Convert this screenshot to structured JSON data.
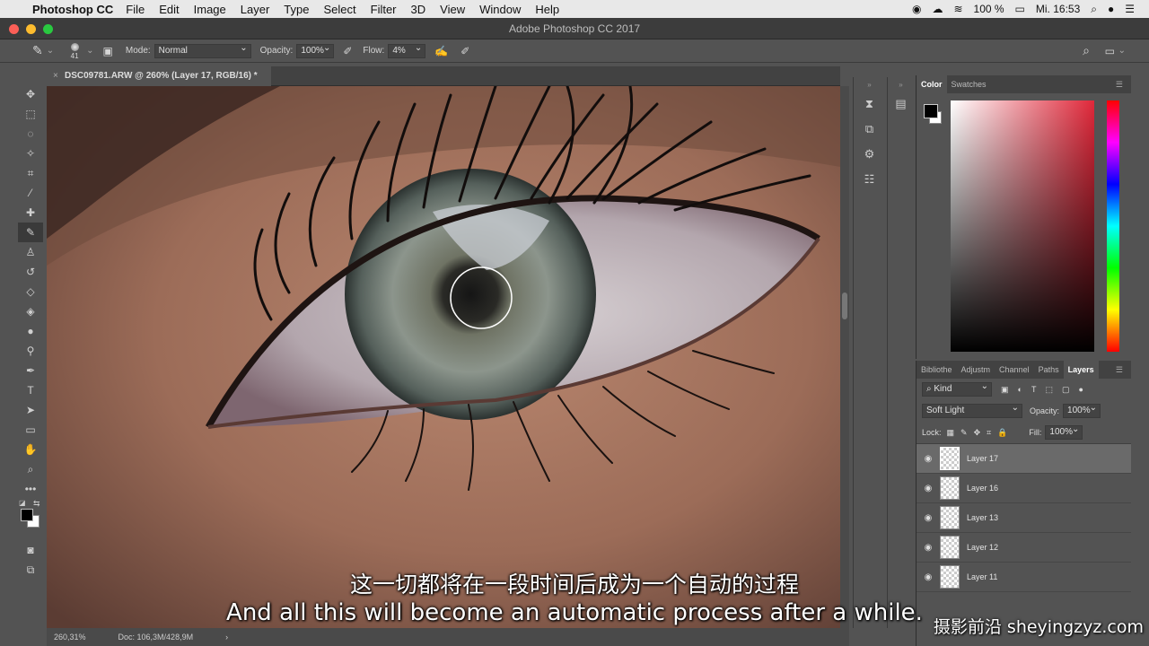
{
  "menubar": {
    "app_name": "Photoshop CC",
    "items": [
      "File",
      "Edit",
      "Image",
      "Layer",
      "Type",
      "Select",
      "Filter",
      "3D",
      "View",
      "Window",
      "Help"
    ],
    "battery": "100 %",
    "clock": "Mi. 16:53"
  },
  "window": {
    "title": "Adobe Photoshop CC 2017"
  },
  "options": {
    "brush_size": "41",
    "mode_label": "Mode:",
    "mode_value": "Normal",
    "opacity_label": "Opacity:",
    "opacity_value": "100%",
    "flow_label": "Flow:",
    "flow_value": "4%"
  },
  "document": {
    "tab_title": "DSC09781.ARW @ 260% (Layer 17, RGB/16) *",
    "zoom": "260,31%",
    "doc_size": "Doc: 106,3M/428,9M"
  },
  "color_panel": {
    "tabs": [
      "Color",
      "Swatches"
    ],
    "active": "Color"
  },
  "layers_panel": {
    "tabs": [
      "Bibliothe",
      "Adjustm",
      "Channel",
      "Paths",
      "Layers"
    ],
    "active": "Layers",
    "filter_label": "Kind",
    "blend_mode": "Soft Light",
    "opacity_label": "Opacity:",
    "opacity_value": "100%",
    "lock_label": "Lock:",
    "fill_label": "Fill:",
    "fill_value": "100%",
    "layers": [
      {
        "name": "Layer 17",
        "selected": true
      },
      {
        "name": "Layer 16",
        "selected": false
      },
      {
        "name": "Layer 13",
        "selected": false
      },
      {
        "name": "Layer 12",
        "selected": false
      },
      {
        "name": "Layer 11",
        "selected": false
      }
    ]
  },
  "subtitles": {
    "chinese": "这一切都将在一段时间后成为一个自动的过程",
    "english": "And all this will become an automatic process after a while."
  },
  "watermark": "摄影前沿 sheyingzyz.com",
  "colors": {
    "foreground": "#000000",
    "background": "#ffffff",
    "hue_selected": "#e0283a"
  }
}
